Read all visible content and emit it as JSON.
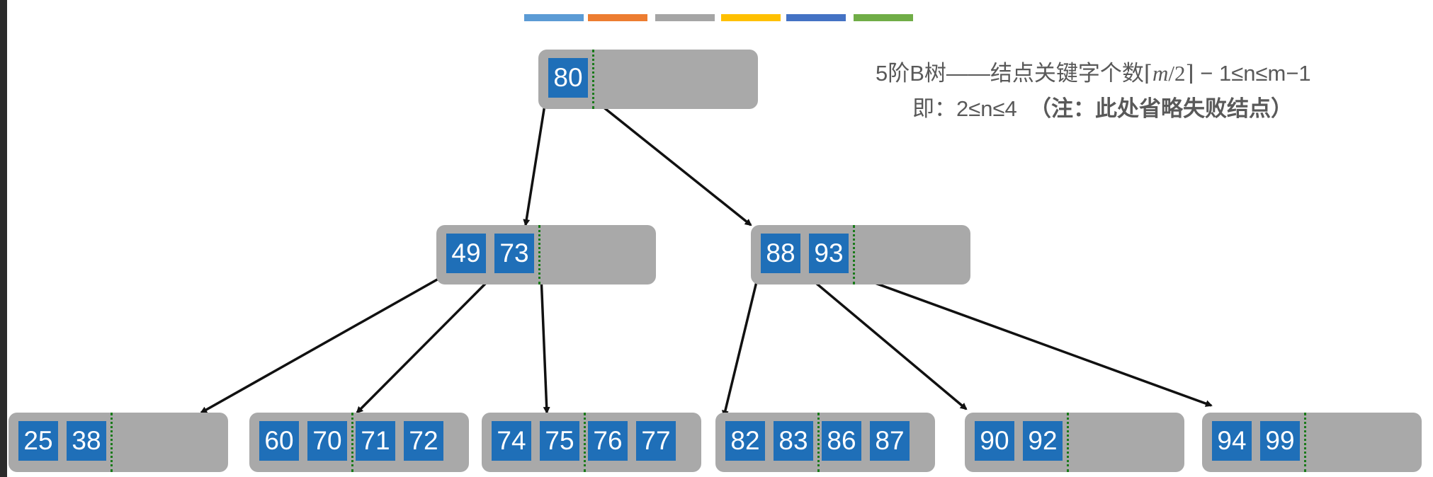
{
  "legend_colors": [
    "#5b9bd5",
    "#ed7d31",
    "#a5a5a5",
    "#ffc000",
    "#4472c4",
    "#70ad47"
  ],
  "colors": {
    "node_fill": "#a9a9a9",
    "key_fill": "#1f6fb8",
    "separator": "#1a7a1a",
    "pointer": "#111111",
    "caption": "#595959"
  },
  "caption": {
    "line1_prefix": "5阶B树——结点关键字个数",
    "line1_ceil_m": "m",
    "line1_ceil_rest": "/2",
    "line1_suffix": " − 1≤n≤m−1",
    "line2_prefix": "即：2≤n≤4",
    "line2_note": "（注：此处省略失败结点）"
  },
  "tree": {
    "order": 5,
    "nodes": [
      {
        "id": "root",
        "keys": [
          "80"
        ]
      },
      {
        "id": "n1",
        "keys": [
          "49",
          "73"
        ]
      },
      {
        "id": "n2",
        "keys": [
          "88",
          "93"
        ]
      },
      {
        "id": "l1",
        "keys": [
          "25",
          "38"
        ]
      },
      {
        "id": "l2",
        "keys": [
          "60",
          "70",
          "71",
          "72"
        ]
      },
      {
        "id": "l3",
        "keys": [
          "74",
          "75",
          "76",
          "77"
        ]
      },
      {
        "id": "l4",
        "keys": [
          "82",
          "83",
          "86",
          "87"
        ]
      },
      {
        "id": "l5",
        "keys": [
          "90",
          "92"
        ]
      },
      {
        "id": "l6",
        "keys": [
          "94",
          "99"
        ]
      }
    ],
    "edges": [
      {
        "from": "root",
        "pointer": 0,
        "to": "n1"
      },
      {
        "from": "root",
        "pointer": 1,
        "to": "n2"
      },
      {
        "from": "n1",
        "pointer": 0,
        "to": "l1"
      },
      {
        "from": "n1",
        "pointer": 1,
        "to": "l2"
      },
      {
        "from": "n1",
        "pointer": 2,
        "to": "l3"
      },
      {
        "from": "n2",
        "pointer": 0,
        "to": "l4"
      },
      {
        "from": "n2",
        "pointer": 1,
        "to": "l5"
      },
      {
        "from": "n2",
        "pointer": 2,
        "to": "l6"
      }
    ]
  }
}
